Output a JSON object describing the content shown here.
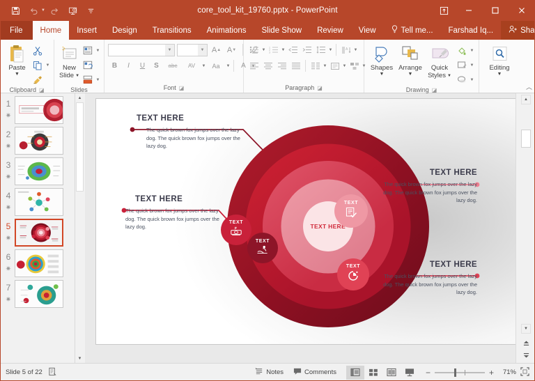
{
  "window": {
    "title": "core_tool_kit_19760.pptx - PowerPoint",
    "quick_access": [
      {
        "name": "save-button",
        "icon": "save-icon"
      },
      {
        "name": "undo-button",
        "icon": "undo-icon"
      },
      {
        "name": "redo-button",
        "icon": "redo-icon"
      },
      {
        "name": "start-presentation-button",
        "icon": "presentation-icon"
      },
      {
        "name": "customize-quick-access-button",
        "icon": "chevron-down-icon"
      }
    ],
    "controls": {
      "ribbon_display": "ribbon-display-options",
      "minimize": "–",
      "maximize": "☐",
      "close": "✕"
    }
  },
  "tabs": {
    "file": "File",
    "items": [
      "Home",
      "Insert",
      "Design",
      "Transitions",
      "Animations",
      "Slide Show",
      "Review",
      "View"
    ],
    "active": "Home",
    "tell_me": "Tell me...",
    "account": "Farshad Iq...",
    "share": "Share"
  },
  "ribbon": {
    "groups": [
      {
        "label": "Clipboard",
        "has_dialog": true
      },
      {
        "label": "Slides",
        "has_dialog": false
      },
      {
        "label": "Font",
        "has_dialog": true
      },
      {
        "label": "Paragraph",
        "has_dialog": true
      },
      {
        "label": "Drawing",
        "has_dialog": true
      },
      {
        "label": "",
        "has_dialog": false
      }
    ],
    "clipboard": {
      "paste_label": "Paste",
      "cut": "cut-icon",
      "copy": "copy-icon",
      "format_painter": "format-painter-icon"
    },
    "slides": {
      "new_slide_label": "New\nSlide",
      "new_slide_line1": "New",
      "new_slide_line2": "Slide",
      "layout": "layout-icon",
      "reset": "reset-icon",
      "section": "section-icon"
    },
    "font": {
      "name_value": "",
      "name_placeholder": "",
      "size_value": "",
      "size_placeholder": "",
      "grow": "A",
      "shrink": "A",
      "clear_formatting": "clear-formatting-icon",
      "bold": "B",
      "italic": "I",
      "underline": "U",
      "shadow": "S",
      "strikethrough": "abc",
      "spacing": "AV",
      "change_case": "Aa",
      "font_color": "A"
    },
    "drawing": {
      "shapes_label": "Shapes",
      "arrange_label": "Arrange",
      "quick_styles_line1": "Quick",
      "quick_styles_line2": "Styles"
    },
    "editing": {
      "label": "Editing",
      "icon": "search-icon"
    },
    "collapse_ribbon": "collapse-ribbon-icon"
  },
  "thumbnails": [
    {
      "number": "1",
      "starred": true,
      "selected": false
    },
    {
      "number": "2",
      "starred": true,
      "selected": false
    },
    {
      "number": "3",
      "starred": true,
      "selected": false
    },
    {
      "number": "4",
      "starred": true,
      "selected": false
    },
    {
      "number": "5",
      "starred": true,
      "selected": true
    },
    {
      "number": "6",
      "starred": true,
      "selected": false
    },
    {
      "number": "7",
      "starred": true,
      "selected": false
    }
  ],
  "slide": {
    "center_label": "TEXT HERE",
    "body_text": "The quick brown fox jumps over the lazy dog. The quick brown fox jumps over the lazy dog.",
    "callouts": [
      {
        "id": "callout-top-left",
        "heading": "TEXT HERE",
        "body": "The quick brown fox jumps over the lazy dog. The quick brown fox jumps over the lazy dog.",
        "bubble_label": "TEXT",
        "bubble_icon": "hand-service-icon",
        "align": "left",
        "accent": "#8d1528"
      },
      {
        "id": "callout-mid-left",
        "heading": "TEXT HERE",
        "body": "The quick brown fox jumps over the lazy dog. The quick brown fox jumps over the lazy dog.",
        "bubble_label": "TEXT",
        "bubble_icon": "money-icon",
        "align": "left",
        "accent": "#c9213a"
      },
      {
        "id": "callout-top-right",
        "heading": "TEXT HERE",
        "body": "The quick brown fox jumps over the lazy dog. The quick brown fox jumps over the lazy dog.",
        "bubble_label": "TEXT",
        "bubble_icon": "document-check-icon",
        "align": "right",
        "accent": "#ef98a4"
      },
      {
        "id": "callout-bottom-right",
        "heading": "TEXT HERE",
        "body": "The quick brown fox jumps over the lazy dog. The quick brown fox jumps over the lazy dog.",
        "bubble_label": "TEXT",
        "bubble_icon": "clock-pie-icon",
        "align": "right",
        "accent": "#e04255"
      }
    ],
    "ring_colors": [
      "#6d0d1c",
      "#a9132a",
      "#c92c43",
      "#e07f8f",
      "#fbe4e6"
    ]
  },
  "status": {
    "slide_counter": "Slide 5 of 22",
    "notes_icon_name": "notes-icon",
    "notes_label": "Notes",
    "comments_icon_name": "comments-icon",
    "comments_label": "Comments",
    "views": [
      {
        "name": "normal-view-button",
        "active": true
      },
      {
        "name": "slide-sorter-view-button",
        "active": false
      },
      {
        "name": "reading-view-button",
        "active": false
      },
      {
        "name": "slide-show-button",
        "active": false
      }
    ],
    "zoom_out": "−",
    "zoom_in": "+",
    "zoom_level": "71%",
    "fit_slide_icon": "fit-to-window-icon"
  },
  "colors": {
    "accent": "#b7472a",
    "file_tab": "#a23b20",
    "share_tab": "#a8401f"
  }
}
